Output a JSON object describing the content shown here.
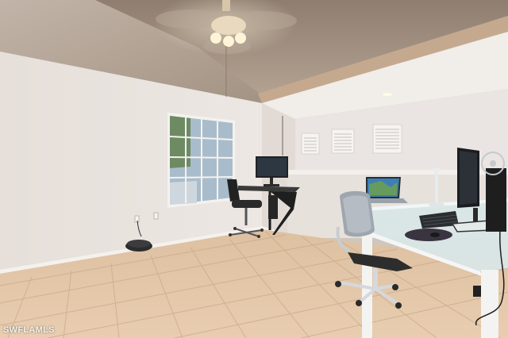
{
  "watermark": {
    "text": "SWFLAMLS"
  },
  "colors": {
    "ceiling": "#a39282",
    "ceiling_light": "#c9b9a7",
    "wall": "#e9e3df",
    "wall_shadow": "#d7cfc9",
    "floor": "#e5c8a8",
    "floor_grout": "#caa988",
    "window_glass": "#aebfcc",
    "window_frame": "#f4f2ef",
    "desk_glass": "#dfeaea",
    "monitor": "#1c1f24",
    "chair_mesh": "#a9b0b8"
  },
  "icons": [
    "ceiling-fan-icon",
    "recessed-light-icon"
  ]
}
